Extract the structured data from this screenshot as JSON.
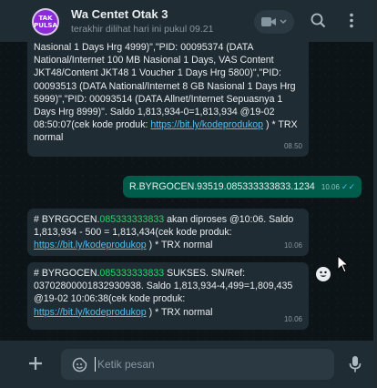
{
  "header": {
    "avatar_line1": "TAK",
    "avatar_line2": "PULSA",
    "chat_name": "Wa Centet Otak 3",
    "status": "terakhir dilihat hari ini pukul 09.21",
    "icons": [
      "video-camera-icon",
      "chevron-down-icon",
      "search-icon",
      "more-vertical-icon"
    ]
  },
  "messages": [
    {
      "direction": "in",
      "text": "Nasional 1 Days Hrg 4999)\",\"PID: 00095374 (DATA National/Internet 100 MB Nasional 1 Days, VAS Content JKT48/Content JKT48 1 Voucher 1 Days Hrg 5800)\",\"PID: 00093513 (DATA National/Internet 8 GB Nasional 1 Days Hrg 5999)\",\"PID: 00093514 (DATA Allnet/Internet Sepuasnya 1 Days Hrg 8999)\". Saldo 1,813,934-0=1,813,934 @19-02 08:50:07(cek kode produk: ",
      "link": "https://bit.ly/kodeprodukop",
      "suffix": " ) * TRX normal",
      "time": "08.50"
    },
    {
      "direction": "out",
      "text": "R.BYRGOCEN.93519.085333333833.1234",
      "time": "10.06",
      "ticks": "✓✓"
    },
    {
      "direction": "in",
      "prefix": "# BYRGOCEN.",
      "number": "085333333833",
      "text": " akan diproses @10:06. Saldo 1,813,934 - 500 = 1,813,434(cek kode produk:  ",
      "link": "https://bit.ly/kodeprodukop",
      "suffix": " ) * TRX normal",
      "time": "10.06"
    },
    {
      "direction": "in",
      "prefix": "# BYRGOCEN.",
      "number": "085333333833",
      "text": " SUKSES. SN/Ref: 0370280000183293093​8. Saldo 1,813,934-4,499=1,809,435 @19-02 10:06:38(cek kode produk:  ",
      "link": "https://bit.ly/kodeprodukop",
      "suffix": " ) * TRX normal",
      "time": "10.06"
    }
  ],
  "footer": {
    "placeholder": "Ketik pesan",
    "icons": [
      "plus-icon",
      "sticker-icon",
      "microphone-icon"
    ]
  },
  "colors": {
    "header_bg": "#202c33",
    "chat_bg": "#0d1418",
    "incoming_bubble": "#202c33",
    "outgoing_bubble": "#005c4b",
    "link": "#53bdeb",
    "phone_number": "#25d366"
  }
}
